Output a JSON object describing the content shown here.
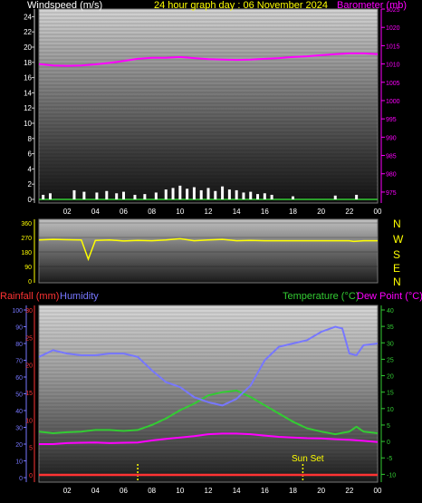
{
  "header": {
    "wind_label": "Windspeed (m/s)",
    "title": "24 hour graph day : 06 November 2024",
    "baro_label": "Barometer (mb)"
  },
  "colors": {
    "wind": "#ffffff",
    "gust": "#33cc33",
    "baro": "#ff00ff",
    "direction": "#ffff00",
    "rain": "#ff3333",
    "humidity": "#7777ff",
    "temperature": "#33cc33",
    "dewpoint": "#ff00ff",
    "sunset": "#ffff00"
  },
  "middle": {
    "compass": [
      "N",
      "W",
      "S",
      "E",
      "N"
    ]
  },
  "bottom_labels": {
    "rainfall": "Rainfall (mm)",
    "humidity": "Humidity",
    "temperature": "Temperature (°C)",
    "dewpoint": "Dew Point (°C)",
    "sunset": "Sun Set"
  },
  "chart_data": [
    {
      "type": "line",
      "name": "wind_baro",
      "x_ticks": [
        "02",
        "04",
        "06",
        "08",
        "10",
        "12",
        "14",
        "16",
        "18",
        "20",
        "22",
        "00"
      ],
      "x_range": [
        0,
        24
      ],
      "y_left_label": "Windspeed (m/s)",
      "y_left_ticks": [
        0,
        2,
        4,
        6,
        8,
        10,
        12,
        14,
        16,
        18,
        20,
        22,
        24
      ],
      "y_left_range": [
        0,
        25
      ],
      "y_right_label": "Barometer (mb)",
      "y_right_ticks": [
        975,
        980,
        985,
        990,
        995,
        1000,
        1005,
        1010,
        1015,
        1020,
        1025
      ],
      "y_right_range": [
        973,
        1025
      ],
      "series": [
        {
          "name": "Barometer (mb)",
          "axis": "right",
          "x": [
            0,
            1,
            2,
            3,
            4,
            5,
            6,
            7,
            8,
            9,
            10,
            11,
            12,
            13,
            14,
            15,
            16,
            17,
            18,
            19,
            20,
            21,
            22,
            23,
            24
          ],
          "values": [
            1010.0,
            1009.6,
            1009.5,
            1009.6,
            1009.9,
            1010.3,
            1010.8,
            1011.4,
            1011.7,
            1011.7,
            1011.9,
            1011.6,
            1011.3,
            1011.2,
            1011.1,
            1011.2,
            1011.4,
            1011.6,
            1011.9,
            1012.1,
            1012.4,
            1012.7,
            1012.9,
            1012.9,
            1012.7
          ]
        },
        {
          "name": "Windspeed",
          "axis": "left",
          "x": [
            0.3,
            0.8,
            2.5,
            3.2,
            4.1,
            4.8,
            5.5,
            6.0,
            6.8,
            7.5,
            8.3,
            9.0,
            9.5,
            10.0,
            10.5,
            11.0,
            11.5,
            12.0,
            12.5,
            13.0,
            13.5,
            14.0,
            14.5,
            15.0,
            15.5,
            16.0,
            16.5,
            18.0,
            21.0,
            22.5
          ],
          "values": [
            0.6,
            0.8,
            1.2,
            1.0,
            0.9,
            1.1,
            0.8,
            1.0,
            0.6,
            0.7,
            0.9,
            1.3,
            1.5,
            1.8,
            1.4,
            1.6,
            1.2,
            1.5,
            1.1,
            1.7,
            1.3,
            1.2,
            0.9,
            1.0,
            0.7,
            0.8,
            0.6,
            0.4,
            0.5,
            0.6
          ]
        },
        {
          "name": "Gust",
          "axis": "left",
          "x": [
            0,
            24
          ],
          "values": [
            0,
            0
          ]
        }
      ]
    },
    {
      "type": "line",
      "name": "wind_direction",
      "x_range": [
        0,
        24
      ],
      "y_ticks": [
        0,
        90,
        180,
        270,
        360
      ],
      "y_range": [
        0,
        360
      ],
      "series": [
        {
          "name": "Wind direction",
          "x": [
            0,
            1,
            2,
            3,
            3.5,
            4,
            5,
            6,
            7,
            8,
            9,
            10,
            11,
            12,
            13,
            14,
            15,
            16,
            16.3,
            17,
            18,
            19,
            20,
            21,
            22,
            22.3,
            23,
            24
          ],
          "values": [
            255,
            258,
            256,
            254,
            135,
            252,
            255,
            248,
            252,
            250,
            255,
            262,
            250,
            255,
            258,
            250,
            252,
            250,
            250,
            250,
            250,
            250,
            250,
            250,
            250,
            245,
            250,
            250
          ]
        }
      ]
    },
    {
      "type": "line",
      "name": "temp_hum_rain",
      "x_ticks": [
        "02",
        "04",
        "06",
        "08",
        "10",
        "12",
        "14",
        "16",
        "18",
        "20",
        "22",
        "00"
      ],
      "x_range": [
        0,
        24
      ],
      "humidity_ticks": [
        0,
        10,
        20,
        30,
        40,
        50,
        60,
        70,
        80,
        90,
        100
      ],
      "humidity_range": [
        0,
        100
      ],
      "rain_ticks": [
        0,
        5,
        10,
        15,
        20,
        25,
        30
      ],
      "rain_range": [
        -0.5,
        30
      ],
      "temp_ticks": [
        -10,
        -5,
        0,
        5,
        10,
        15,
        20,
        25,
        30,
        35,
        40
      ],
      "temp_range": [
        -11,
        40
      ],
      "sunset_hour": 18.7,
      "series": [
        {
          "name": "Humidity",
          "axis": "humidity",
          "x": [
            0,
            1,
            2,
            3,
            4,
            5,
            6,
            7,
            8,
            9,
            10,
            11,
            12,
            13,
            14,
            15,
            16,
            17,
            18,
            19,
            20,
            21,
            21.5,
            22,
            22.5,
            23,
            24
          ],
          "values": [
            72,
            76,
            74,
            73,
            73,
            74,
            74,
            72,
            64,
            57,
            54,
            48,
            45,
            43,
            47,
            55,
            70,
            78,
            80,
            82,
            87,
            90,
            89,
            74,
            73,
            79,
            80
          ]
        },
        {
          "name": "Temperature (°C)",
          "axis": "temp",
          "x": [
            0,
            1,
            2,
            3,
            4,
            5,
            6,
            7,
            8,
            9,
            10,
            11,
            12,
            13,
            14,
            15,
            16,
            17,
            18,
            19,
            20,
            21,
            22,
            22.5,
            23,
            24
          ],
          "values": [
            3.0,
            2.5,
            2.8,
            3.0,
            3.5,
            3.5,
            3.2,
            3.5,
            5.0,
            7.0,
            9.5,
            11.5,
            14.0,
            15.0,
            15.5,
            13.5,
            11.0,
            8.5,
            6.0,
            4.0,
            3.0,
            2.2,
            3.0,
            4.5,
            3.0,
            2.5
          ]
        },
        {
          "name": "Dew Point (°C)",
          "axis": "temp",
          "x": [
            0,
            1,
            2,
            3,
            4,
            5,
            6,
            7,
            8,
            9,
            10,
            11,
            12,
            13,
            14,
            15,
            16,
            17,
            18,
            19,
            20,
            21,
            22,
            23,
            24
          ],
          "values": [
            -0.8,
            -0.8,
            -0.5,
            -0.4,
            -0.3,
            -0.5,
            -0.4,
            -0.3,
            0.3,
            0.8,
            1.2,
            1.6,
            2.2,
            2.4,
            2.4,
            2.2,
            1.8,
            1.4,
            1.2,
            1.0,
            0.9,
            0.7,
            0.5,
            0.2,
            -0.2
          ]
        },
        {
          "name": "Rainfall (mm)",
          "axis": "rain",
          "x": [
            0,
            24
          ],
          "values": [
            0,
            0
          ]
        }
      ]
    }
  ]
}
